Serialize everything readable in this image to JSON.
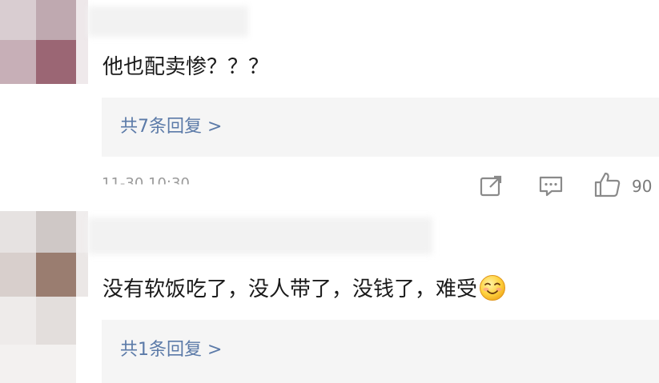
{
  "comments": [
    {
      "text": "他也配卖惨？？？",
      "reply_link": "共7条回复 >",
      "timestamp": "11-30 10:30",
      "like_count": "90",
      "avatar_colors": [
        "#cbbcc1",
        "#a98a93",
        "#e2d9dc",
        "#c6adb5",
        "#9d6a76",
        "#e9e3e5"
      ]
    },
    {
      "text": "没有软饭吃了，没人带了，没钱了，难受",
      "emoji": "smile-emoji",
      "reply_link": "共1条回复 >",
      "avatar_colors": [
        "#d9d1cf",
        "#bdb3b0",
        "#ece8e7",
        "#cfc5c3",
        "#9c8073",
        "#efebea"
      ]
    }
  ],
  "icons": {
    "share": "share-external-icon",
    "comment": "comment-bubble-icon",
    "like": "thumbs-up-icon"
  },
  "colors": {
    "link": "#5b7aa8",
    "reply_box": "#f5f5f5",
    "meta_text": "#9b9b9b"
  }
}
